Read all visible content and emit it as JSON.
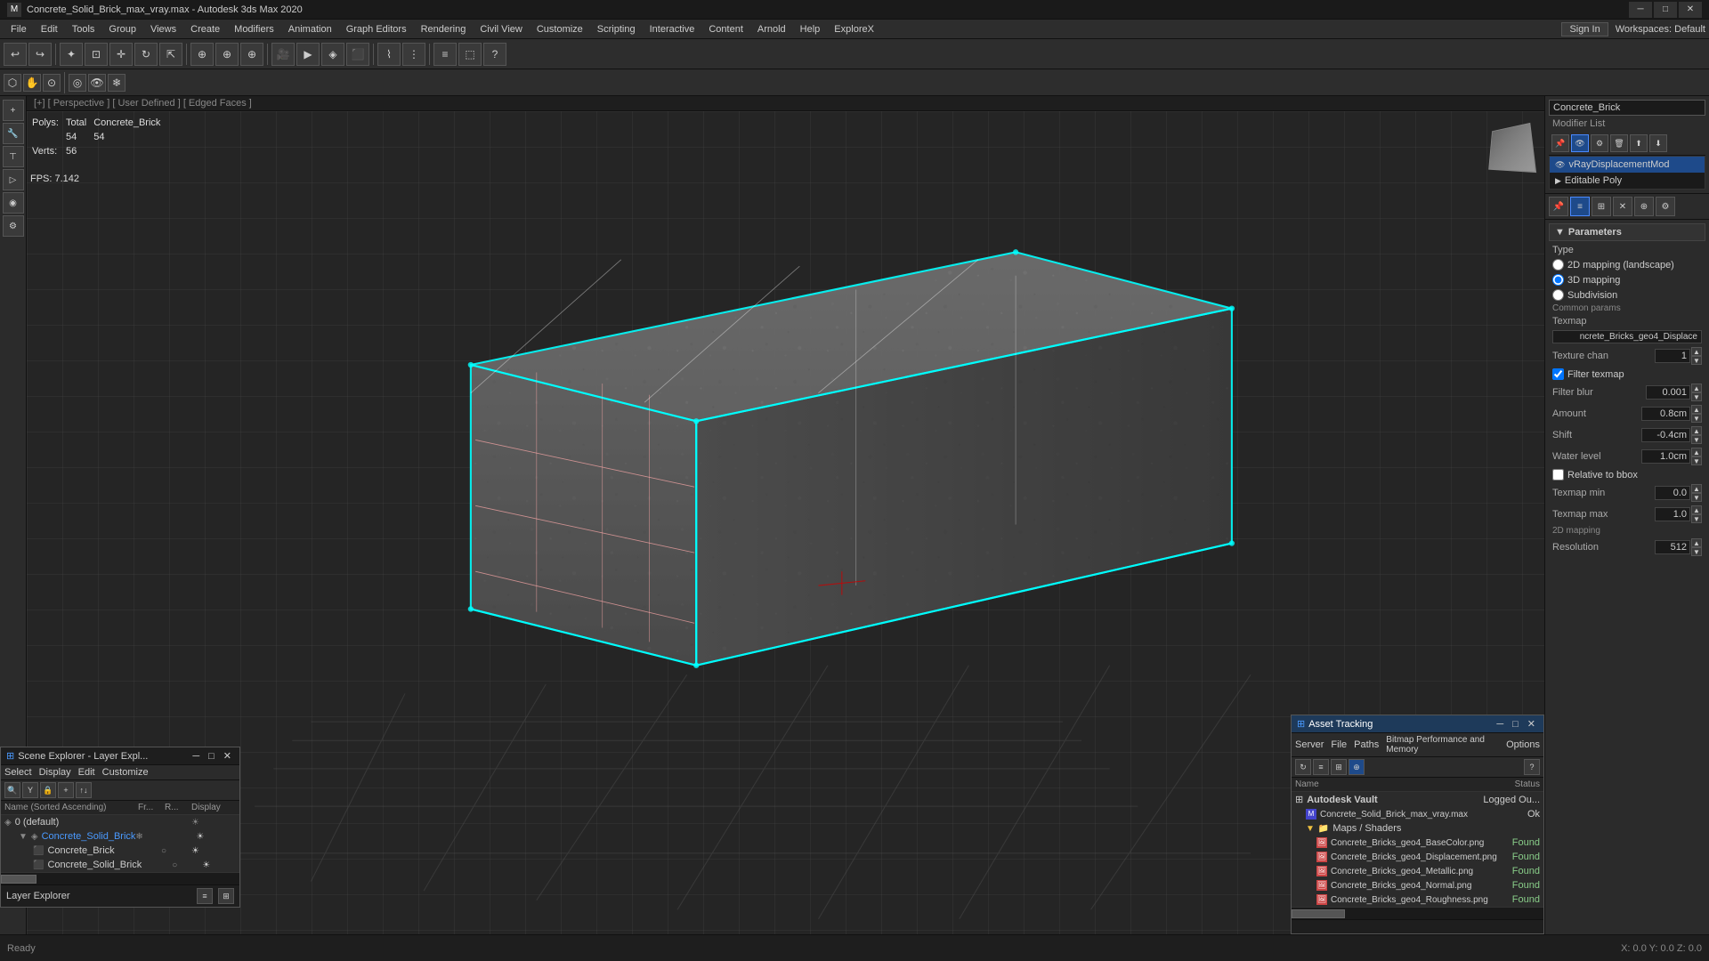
{
  "titlebar": {
    "title": "Concrete_Solid_Brick_max_vray.max - Autodesk 3ds Max 2020",
    "app_icon": "M"
  },
  "menubar": {
    "items": [
      "File",
      "Edit",
      "Tools",
      "Group",
      "Views",
      "Create",
      "Modifiers",
      "Animation",
      "Graph Editors",
      "Rendering",
      "Civil View",
      "Customize",
      "Scripting",
      "Interactive",
      "Content",
      "Arnold",
      "Help",
      "ExploreX"
    ],
    "sign_in_label": "Sign In",
    "workspaces_label": "Workspaces: Default"
  },
  "viewport": {
    "label": "[+] [ Perspective ] [ User Defined ] [ Edged Faces ]",
    "object_info": {
      "polys_label": "Polys:",
      "polys_total": "Total",
      "polys_total_val": "54",
      "polys_obj": "Concrete_Brick",
      "polys_val": "54",
      "verts_label": "Verts:",
      "verts_val": "56"
    },
    "fps": "FPS: 7.142"
  },
  "right_panel": {
    "modifier_name_input": "Concrete_Brick",
    "modifier_list_label": "Modifier List",
    "modifiers": [
      {
        "name": "vRayDisplacementMod",
        "active": true
      },
      {
        "name": "Editable Poly",
        "active": false
      }
    ],
    "parameters": {
      "section_label": "Parameters",
      "type_label": "Type",
      "type_options": [
        "2D mapping (landscape)",
        "3D mapping",
        "Subdivision"
      ],
      "type_selected": "3D mapping",
      "common_params_label": "Common params",
      "texmap_label": "Texmap",
      "texmap_value": "ncrete_Bricks_geo4_Displace",
      "texture_chan_label": "Texture chan",
      "texture_chan_value": "1",
      "filter_texmap_label": "Filter texmap",
      "filter_texmap_checked": true,
      "filter_blur_label": "Filter blur",
      "filter_blur_value": "0.001",
      "amount_label": "Amount",
      "amount_value": "0.8cm",
      "shift_label": "Shift",
      "shift_value": "-0.4cm",
      "water_level_label": "Water level",
      "water_level_value": "1.0cm",
      "relative_to_bbox_label": "Relative to bbox",
      "texmap_min_label": "Texmap min",
      "texmap_min_value": "0.0",
      "texmap_max_label": "Texmap max",
      "texmap_max_value": "1.0",
      "mapping_2d_label": "2D mapping",
      "resolution_label": "Resolution",
      "resolution_value": "512"
    }
  },
  "scene_explorer": {
    "title": "Scene Explorer - Layer Expl...",
    "menus": [
      "Select",
      "Display",
      "Edit",
      "Customize"
    ],
    "columns": {
      "name": "Name (Sorted Ascending)",
      "fr1": "Fr...",
      "fr2": "R...",
      "display": "Display"
    },
    "rows": [
      {
        "name": "0 (default)",
        "level": 0,
        "type": "layer"
      },
      {
        "name": "Concrete_Solid_Brick",
        "level": 1,
        "type": "layer"
      },
      {
        "name": "Concrete_Brick",
        "level": 2,
        "type": "object"
      },
      {
        "name": "Concrete_Solid_Brick",
        "level": 2,
        "type": "object"
      }
    ],
    "footer_label": "Layer Explorer"
  },
  "asset_tracking": {
    "title": "Asset Tracking",
    "menus": [
      "Server",
      "File",
      "Paths",
      "Bitmap Performance and Memory",
      "Options"
    ],
    "columns": {
      "name": "Name",
      "status": "Status"
    },
    "rows": [
      {
        "name": "Autodesk Vault",
        "level": 0,
        "type": "category",
        "status": "Logged Ou..."
      },
      {
        "name": "Concrete_Solid_Brick_max_vray.max",
        "level": 0,
        "type": "file",
        "status": "Ok"
      },
      {
        "name": "Maps / Shaders",
        "level": 1,
        "type": "folder"
      },
      {
        "name": "Concrete_Bricks_geo4_BaseColor.png",
        "level": 2,
        "type": "image",
        "status": "Found"
      },
      {
        "name": "Concrete_Bricks_geo4_Displacement.png",
        "level": 2,
        "type": "image",
        "status": "Found"
      },
      {
        "name": "Concrete_Bricks_geo4_Metallic.png",
        "level": 2,
        "type": "image",
        "status": "Found"
      },
      {
        "name": "Concrete_Bricks_geo4_Normal.png",
        "level": 2,
        "type": "image",
        "status": "Found"
      },
      {
        "name": "Concrete_Bricks_geo4_Roughness.png",
        "level": 2,
        "type": "image",
        "status": "Found"
      }
    ]
  },
  "status_bar": {
    "coords": "X: 0.0  Y: 0.0  Z: 0.0"
  }
}
